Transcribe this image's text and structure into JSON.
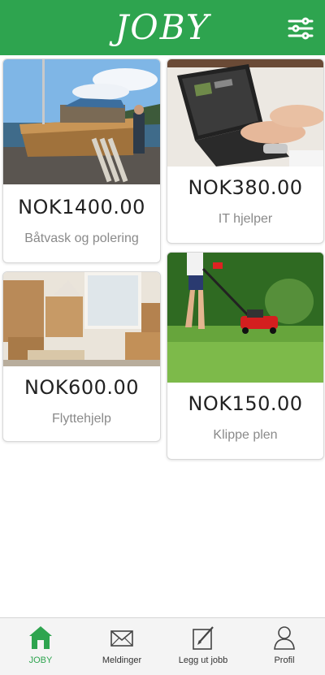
{
  "app": {
    "logo": "JOBY",
    "brand_color": "#2ea44f"
  },
  "header": {
    "filter_icon": "sliders-icon"
  },
  "jobs": [
    {
      "price": "NOK1400.00",
      "title": "Båtvask og polering",
      "image": "boat-photo"
    },
    {
      "price": "NOK380.00",
      "title": "IT hjelper",
      "image": "laptop-photo"
    },
    {
      "price": "NOK600.00",
      "title": "Flyttehjelp",
      "image": "moving-boxes-photo"
    },
    {
      "price": "NOK150.00",
      "title": "Klippe plen",
      "image": "lawn-mower-photo"
    }
  ],
  "tabbar": {
    "items": [
      {
        "label": "JOBY",
        "icon": "home-icon",
        "active": true
      },
      {
        "label": "Meldinger",
        "icon": "envelope-icon",
        "active": false
      },
      {
        "label": "Legg ut jobb",
        "icon": "edit-icon",
        "active": false
      },
      {
        "label": "Profil",
        "icon": "user-icon",
        "active": false
      }
    ]
  }
}
